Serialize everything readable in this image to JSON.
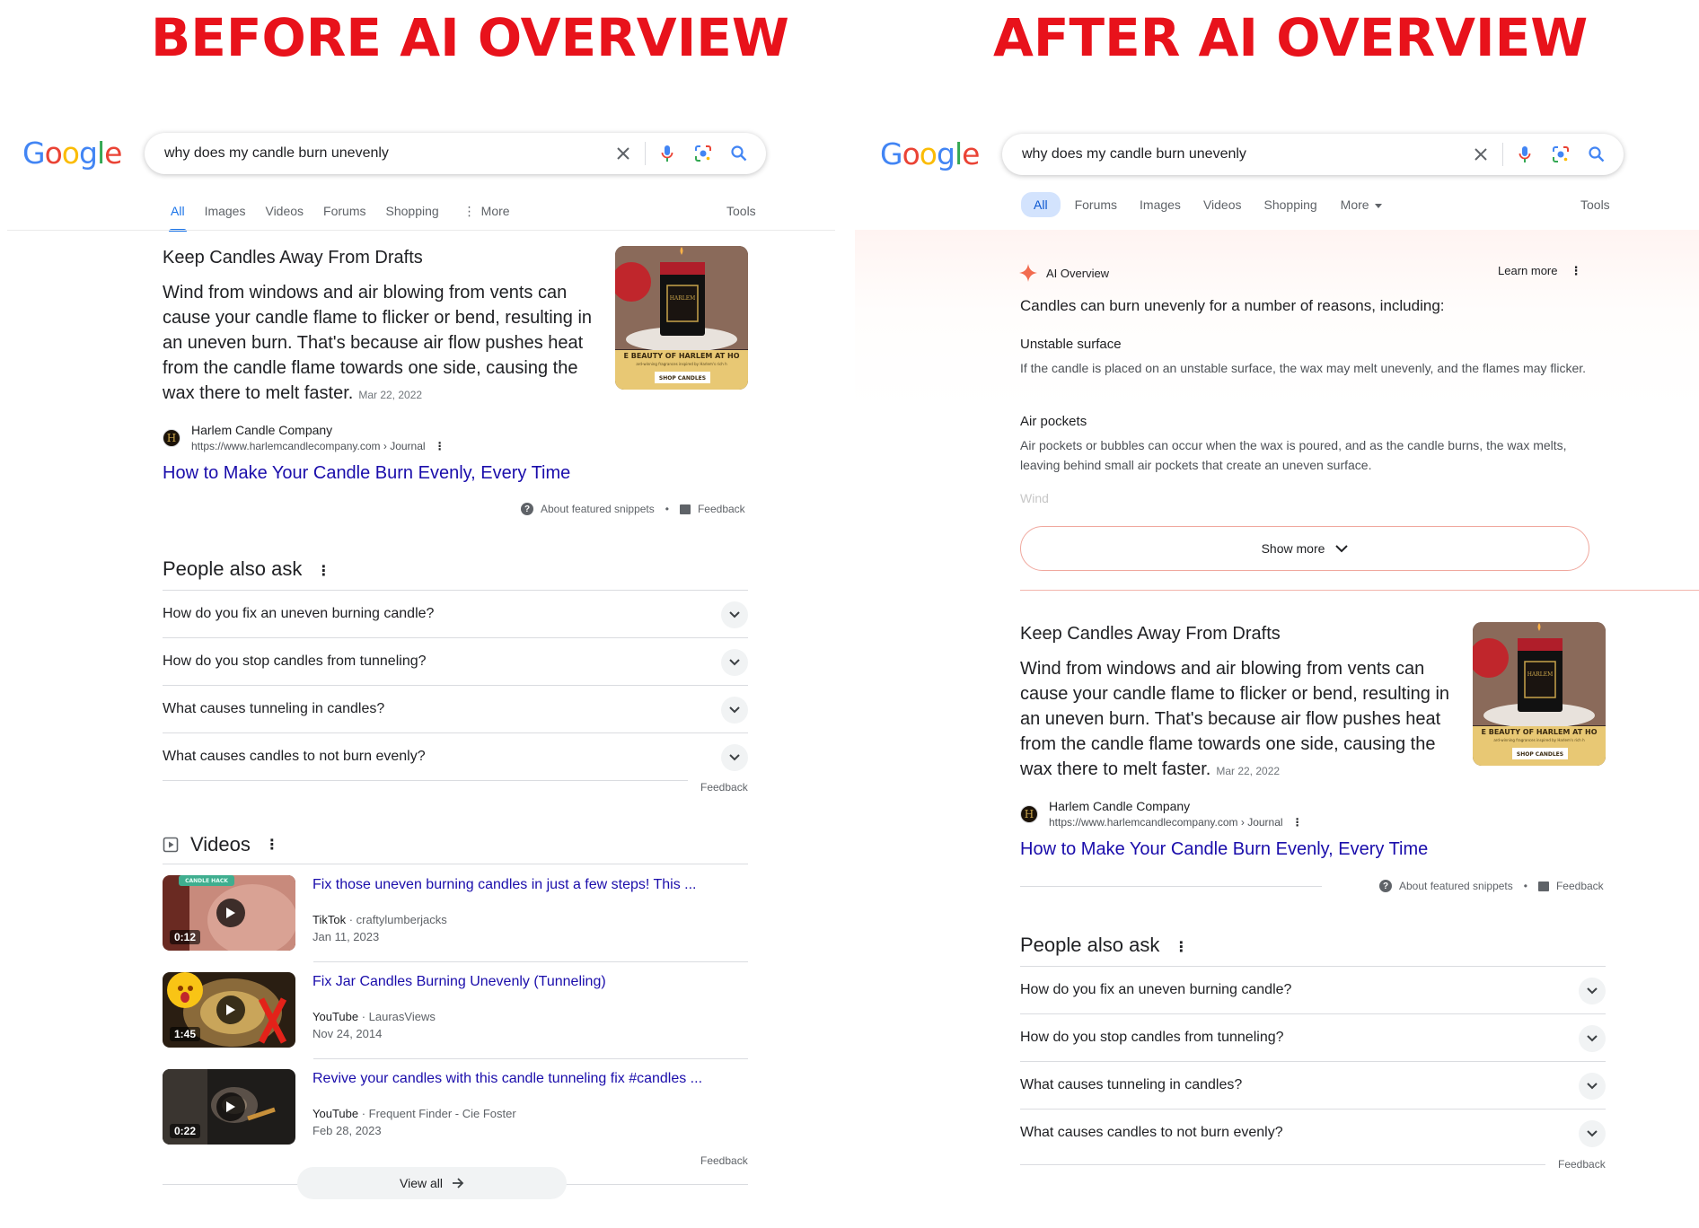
{
  "headings": {
    "before": "BEFORE AI OVERVIEW",
    "after": "AFTER AI OVERVIEW"
  },
  "colors": {
    "heading_red": "#e8121b",
    "link_blue": "#1a0dab",
    "tab_blue": "#1a73e8"
  },
  "logo": {
    "text": "Google"
  },
  "search": {
    "query": "why does my candle burn unevenly"
  },
  "icons": [
    "close-icon",
    "mic-icon",
    "lens-icon",
    "search-icon",
    "chevron-down-icon",
    "play-icon",
    "help-icon",
    "feedback-icon",
    "more-vert-icon",
    "video-icon",
    "sparkle-icon",
    "arrow-right-icon"
  ],
  "before": {
    "tabs": [
      "All",
      "Images",
      "Videos",
      "Forums",
      "Shopping",
      "More"
    ],
    "tools": "Tools",
    "more_prefix": "⋮"
  },
  "after": {
    "tabs": [
      "All",
      "Forums",
      "Images",
      "Videos",
      "Shopping",
      "More"
    ],
    "tools": "Tools"
  },
  "snippet": {
    "title": "Keep Candles Away From Drafts",
    "text": "Wind from windows and air blowing from vents can cause your candle flame to flicker or bend, resulting in an uneven burn. That's because air flow pushes heat from the candle flame towards one side, causing the wax there to melt faster.",
    "date": "Mar 22, 2022",
    "site_name": "Harlem Candle Company",
    "site_url": "https://www.harlemcandlecompany.com › Journal",
    "favicon_letter": "H",
    "link": "How to Make Your Candle Burn Evenly, Every Time",
    "about": "About featured snippets",
    "bullet": "•",
    "feedback": "Feedback",
    "image_banner": "E BEAUTY OF HARLEM AT HO",
    "image_subbanner": "ard-winning fragrances inspired by Harlem's rich h",
    "image_button": "SHOP CANDLES",
    "image_label": "HARLEM"
  },
  "paa": {
    "title": "People also ask",
    "questions": [
      "How do you fix an uneven burning candle?",
      "How do you stop candles from tunneling?",
      "What causes tunneling in candles?",
      "What causes candles to not burn evenly?"
    ],
    "feedback": "Feedback"
  },
  "videos": {
    "title": "Videos",
    "items": [
      {
        "title": "Fix those uneven burning candles in just a few steps! This ...",
        "platform": "TikTok",
        "author": "craftylumberjacks",
        "date": "Jan 11, 2023",
        "duration": "0:12",
        "badge": "CANDLE HACK"
      },
      {
        "title": "Fix Jar Candles Burning Unevenly (Tunneling)",
        "platform": "YouTube",
        "author": "LaurasViews",
        "date": "Nov 24, 2014",
        "duration": "1:45"
      },
      {
        "title": "Revive your candles with this candle tunneling fix #candles ...",
        "platform": "YouTube",
        "author": "Frequent Finder - Cie Foster",
        "date": "Feb 28, 2023",
        "duration": "0:22"
      }
    ],
    "feedback": "Feedback",
    "view_all": "View all",
    "sep": " · "
  },
  "ai": {
    "label": "AI Overview",
    "learn_more": "Learn more",
    "intro": "Candles can burn unevenly for a number of reasons, including:",
    "sections": [
      {
        "heading": "Unstable surface",
        "text": "If the candle is placed on an unstable surface, the wax may melt unevenly, and the flames may flicker."
      },
      {
        "heading": "Air pockets",
        "text": "Air pockets or bubbles can occur when the wax is poured, and as the candle burns, the wax melts, leaving behind small air pockets that create an uneven surface."
      }
    ],
    "faded": "Wind",
    "show_more": "Show more"
  }
}
